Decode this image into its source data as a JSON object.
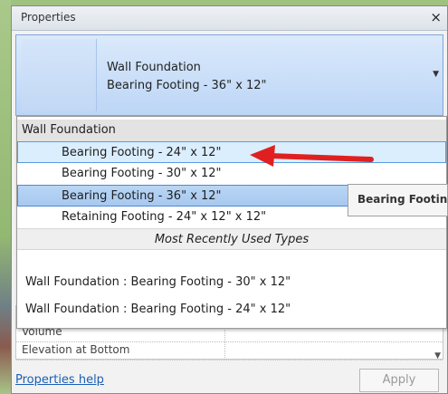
{
  "panel": {
    "title": "Properties",
    "close_icon": "×"
  },
  "type_selector": {
    "family": "Wall Foundation",
    "type": "Bearing Footing - 36\" x 12\""
  },
  "dropdown": {
    "group_header": "Wall Foundation",
    "items": [
      "Bearing Footing - 24\" x 12\"",
      "Bearing Footing - 30\" x 12\"",
      "Bearing Footing - 36\" x 12\"",
      "Retaining Footing - 24\" x 12\" x 12\""
    ],
    "selected_index": 2,
    "hovered_index": 0,
    "recent_header": "Most Recently Used Types",
    "recent_items": [
      "Wall Foundation : Bearing Footing - 30\" x 12\"",
      "Wall Foundation : Bearing Footing - 24\" x 12\""
    ]
  },
  "tooltip": {
    "text": "Bearing Footin"
  },
  "properties": {
    "rows": [
      "Volume",
      "Elevation at Bottom"
    ]
  },
  "footer": {
    "help_link": "Properties help",
    "apply_button": "Apply"
  },
  "colors": {
    "accent_blue": "#4e89d5",
    "annotation_arrow": "#e02020",
    "link": "#1a5fb4"
  }
}
